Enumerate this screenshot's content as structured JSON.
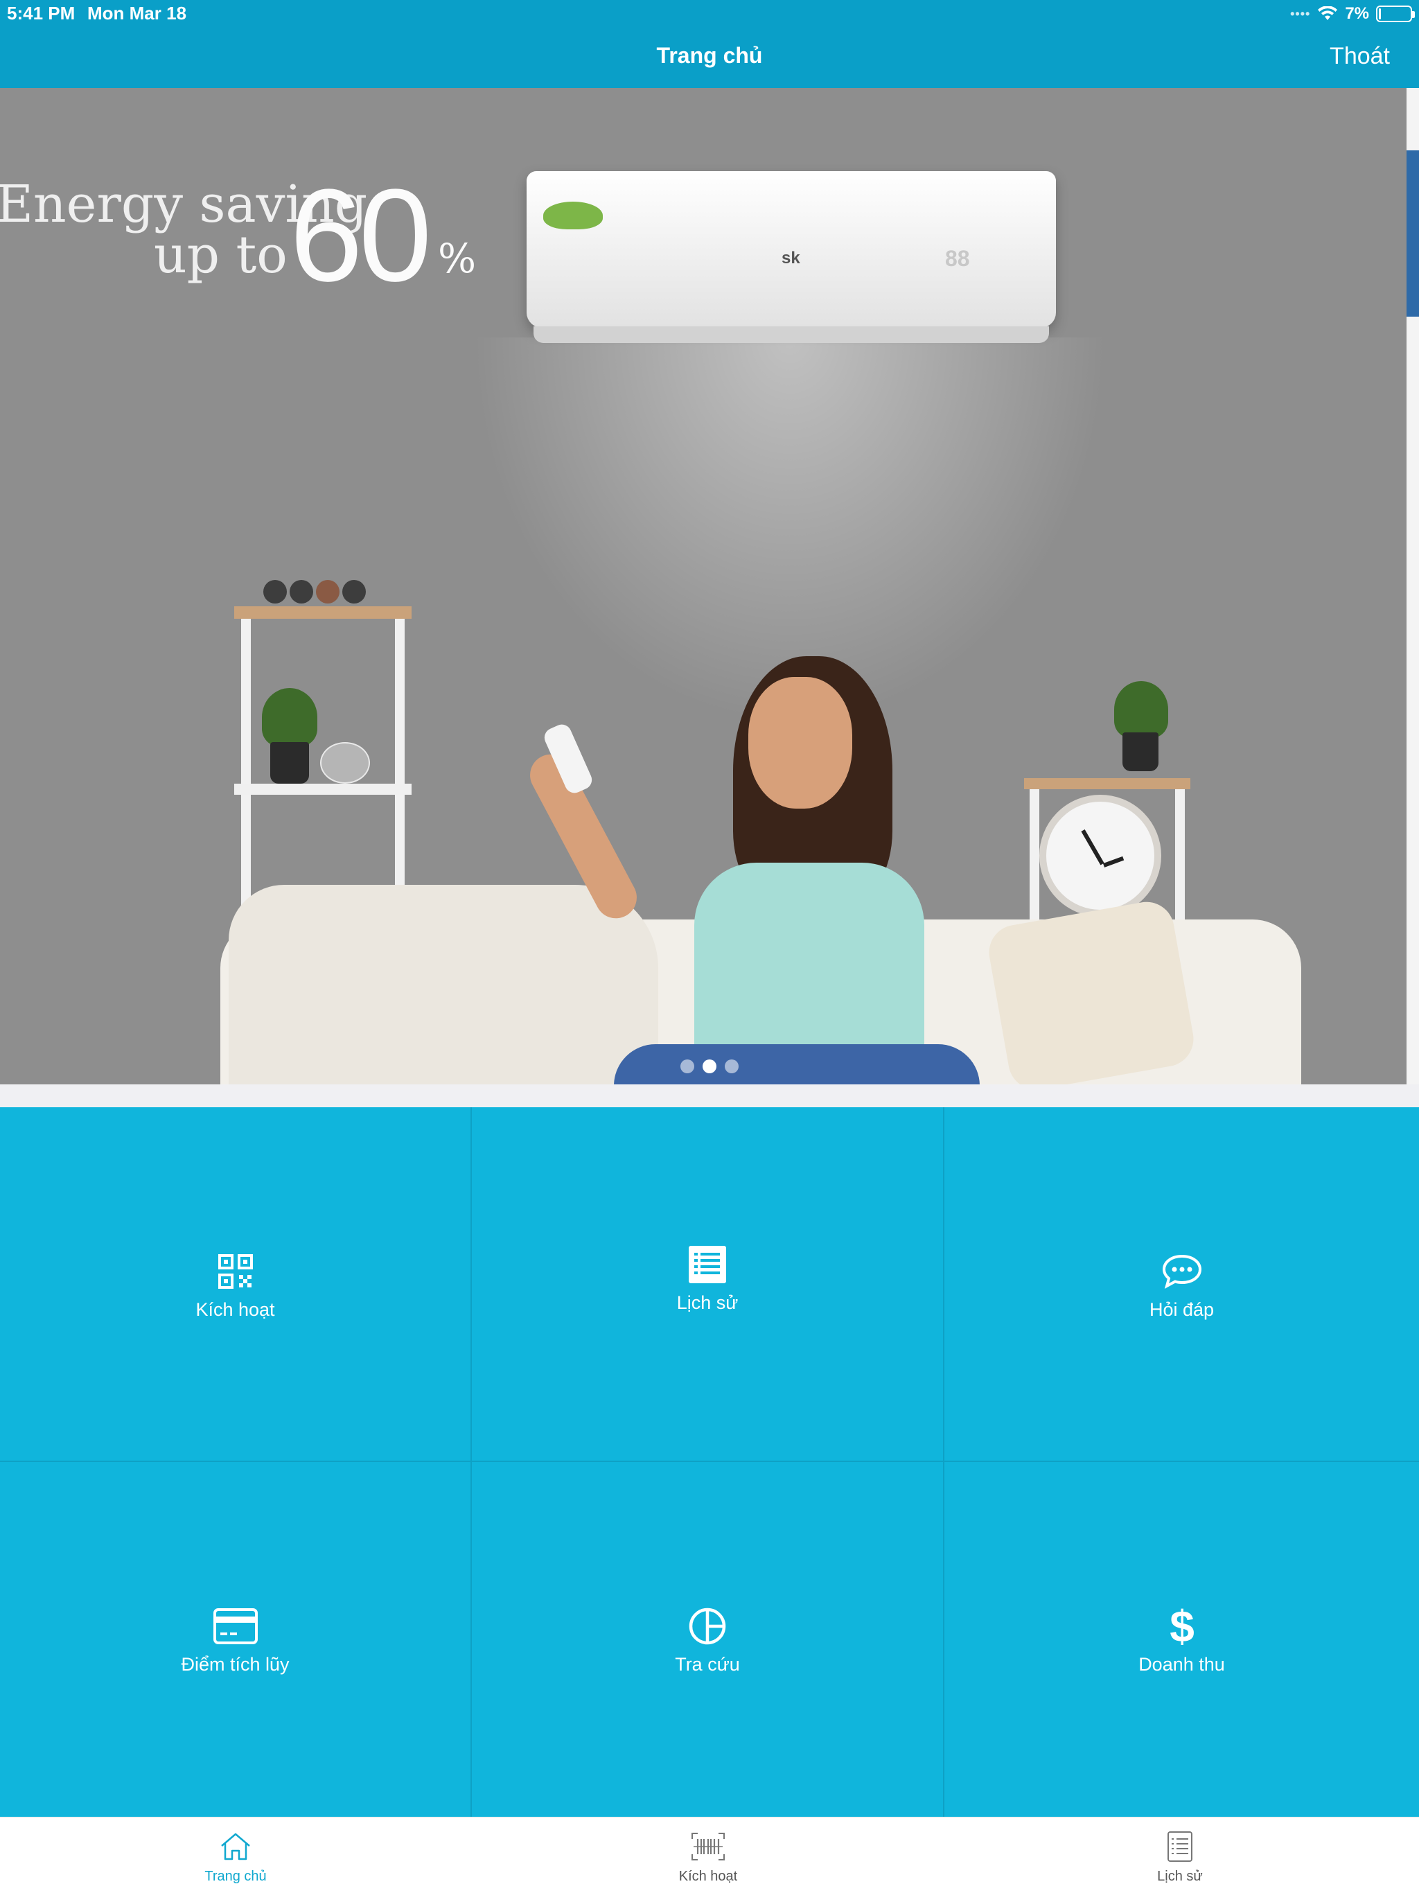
{
  "status_bar": {
    "time": "5:41 PM",
    "date": "Mon Mar 18",
    "battery_text": "7%",
    "battery_level": 0.07
  },
  "nav": {
    "title": "Trang chủ",
    "logout_label": "Thoát"
  },
  "banner": {
    "headline_line1": "Energy saving",
    "headline_line2": "up to",
    "headline_big": "60",
    "headline_pct": "%",
    "ac_logo": "sk",
    "ac_display": "88",
    "dot_count": 3,
    "active_dot": 1
  },
  "menu": {
    "tiles": [
      {
        "label": "Kích hoạt",
        "icon": "qr-code-icon"
      },
      {
        "label": "Lịch sử",
        "icon": "list-icon"
      },
      {
        "label": "Hỏi đáp",
        "icon": "chat-bubble-icon"
      },
      {
        "label": "Điểm tích lũy",
        "icon": "credit-card-icon"
      },
      {
        "label": "Tra cứu",
        "icon": "pie-chart-icon"
      },
      {
        "label": "Doanh thu",
        "icon": "dollar-icon"
      }
    ]
  },
  "tabbar": {
    "tabs": [
      {
        "label": "Trang chủ",
        "icon": "home-icon",
        "active": true
      },
      {
        "label": "Kích hoạt",
        "icon": "barcode-scan-icon",
        "active": false
      },
      {
        "label": "Lịch sử",
        "icon": "document-list-icon",
        "active": false
      }
    ]
  },
  "colors": {
    "nav_bg": "#0a9fc8",
    "tile_bg": "#10b5dc",
    "tab_active": "#10a8cf"
  }
}
